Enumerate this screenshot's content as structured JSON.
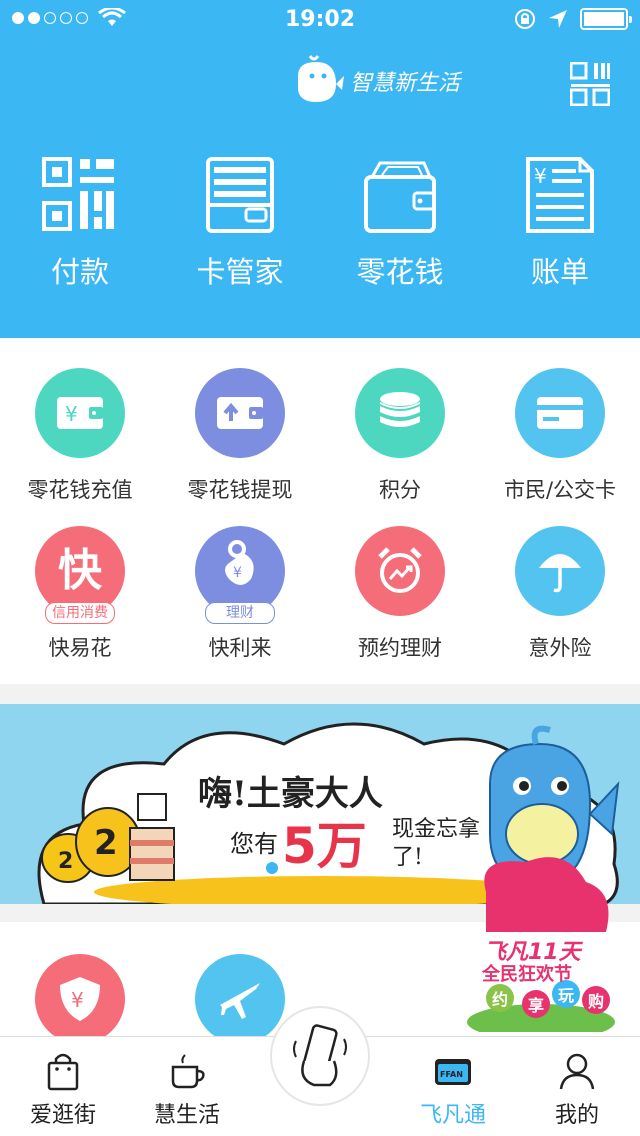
{
  "status": {
    "time": "19:02"
  },
  "header": {
    "logo_text": "智慧新生活"
  },
  "quick_actions": [
    {
      "label": "付款"
    },
    {
      "label": "卡管家"
    },
    {
      "label": "零花钱"
    },
    {
      "label": "账单"
    }
  ],
  "services": [
    {
      "label": "零花钱充值",
      "color": "#4dd7c0"
    },
    {
      "label": "零花钱提现",
      "color": "#7d8ee0"
    },
    {
      "label": "积分",
      "color": "#4dd7c0"
    },
    {
      "label": "市民/公交卡",
      "color": "#52c4ef"
    },
    {
      "label": "快易花",
      "color": "#f46d78",
      "icon_text": "快",
      "badge": "信用消费"
    },
    {
      "label": "快利来",
      "color": "#7d8ee0",
      "badge": "理财"
    },
    {
      "label": "预约理财",
      "color": "#f46d78"
    },
    {
      "label": "意外险",
      "color": "#52c4ef"
    }
  ],
  "banner": {
    "line1": "嗨!土豪大人",
    "line2a": "您有",
    "amount": "5万",
    "line2b": "现金忘拿了!"
  },
  "promo": {
    "title": "飞凡11天",
    "subtitle": "全民狂欢节",
    "tags": [
      "约",
      "享",
      "玩",
      "购"
    ]
  },
  "tabs": [
    {
      "label": "爱逛街"
    },
    {
      "label": "慧生活"
    },
    {
      "label": "飞凡通"
    },
    {
      "label": "我的"
    }
  ],
  "colors": {
    "brand": "#3bb7f3",
    "pink": "#f46d78",
    "purple": "#7d8ee0",
    "teal": "#4dd7c0"
  }
}
